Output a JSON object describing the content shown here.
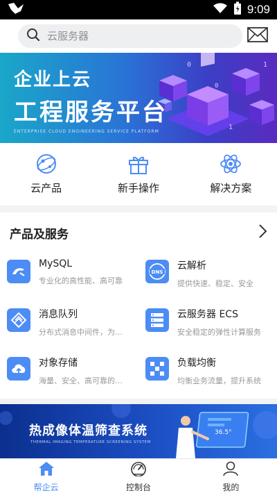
{
  "status_bar": {
    "time": "9:09"
  },
  "search": {
    "placeholder": "云服务器"
  },
  "banner": {
    "title_line1": "企业上云",
    "title_line2": "工程服务平台",
    "subtitle": "ENTERPRISE CLOUD ENGINEERING SERVICE PLATFORM"
  },
  "quick_links": [
    {
      "label": "云产品",
      "icon": "cloud-product-icon"
    },
    {
      "label": "新手操作",
      "icon": "gift-icon"
    },
    {
      "label": "解决方案",
      "icon": "atom-icon"
    }
  ],
  "products": {
    "title": "产品及服务",
    "items": [
      {
        "name": "MySQL",
        "desc": "专业化的高性能、高可靠",
        "icon": "mysql-icon"
      },
      {
        "name": "云解析",
        "desc": "提供快速、稳定、安全",
        "icon": "dns-icon"
      },
      {
        "name": "消息队列",
        "desc": "分布式消息中间件，为应用",
        "icon": "message-queue-icon"
      },
      {
        "name": "云服务器 ECS",
        "desc": "安全稳定的弹性计算服务",
        "icon": "server-icon"
      },
      {
        "name": "对象存储",
        "desc": "海量、安全、高可靠的云存储",
        "icon": "cloud-upload-icon"
      },
      {
        "name": "负载均衡",
        "desc": "均衡业务流量，提升系统",
        "icon": "load-balance-icon"
      }
    ]
  },
  "banner2": {
    "title": "热成像体温筛查系统",
    "subtitle": "THERMAL IMAGING TEMPERATURE SCREENING SYSTEM",
    "reading": "36.5°"
  },
  "tabs": [
    {
      "label": "帮企云",
      "active": true
    },
    {
      "label": "控制台",
      "active": false
    },
    {
      "label": "我的",
      "active": false
    }
  ],
  "colors": {
    "accent": "#4c8cf5",
    "status_bar": "#000000"
  }
}
